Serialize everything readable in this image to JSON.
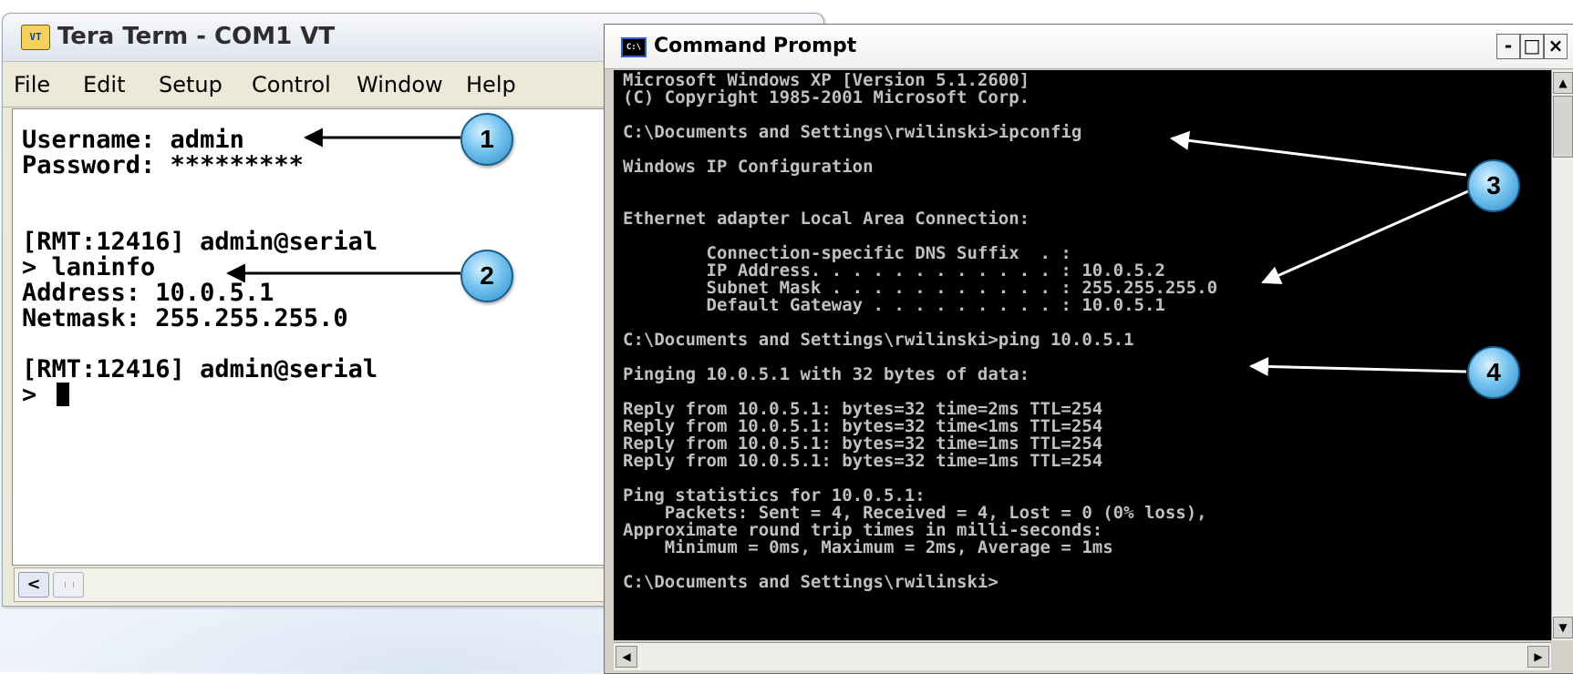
{
  "tera_term": {
    "title": "Tera Term - COM1 VT",
    "app_icon_text": "VT",
    "menu": [
      "File",
      "Edit",
      "Setup",
      "Control",
      "Window",
      "Help"
    ],
    "terminal_lines": [
      "Username: admin",
      "Password: *********",
      "",
      "",
      "[RMT:12416] admin@serial",
      "> laninfo",
      "Address: 10.0.5.1",
      "Netmask: 255.255.255.0",
      "",
      "[RMT:12416] admin@serial",
      "> "
    ]
  },
  "command_prompt": {
    "title": "Command Prompt",
    "icon_text": "C:\\",
    "buttons": {
      "minimize": "-",
      "maximize": "□",
      "close": "×"
    },
    "console_lines": [
      "Microsoft Windows XP [Version 5.1.2600]",
      "(C) Copyright 1985-2001 Microsoft Corp.",
      "",
      "C:\\Documents and Settings\\rwilinski>ipconfig",
      "",
      "Windows IP Configuration",
      "",
      "",
      "Ethernet adapter Local Area Connection:",
      "",
      "        Connection-specific DNS Suffix  . :",
      "        IP Address. . . . . . . . . . . . : 10.0.5.2",
      "        Subnet Mask . . . . . . . . . . . : 255.255.255.0",
      "        Default Gateway . . . . . . . . . : 10.0.5.1",
      "",
      "C:\\Documents and Settings\\rwilinski>ping 10.0.5.1",
      "",
      "Pinging 10.0.5.1 with 32 bytes of data:",
      "",
      "Reply from 10.0.5.1: bytes=32 time=2ms TTL=254",
      "Reply from 10.0.5.1: bytes=32 time<1ms TTL=254",
      "Reply from 10.0.5.1: bytes=32 time=1ms TTL=254",
      "Reply from 10.0.5.1: bytes=32 time=1ms TTL=254",
      "",
      "Ping statistics for 10.0.5.1:",
      "    Packets: Sent = 4, Received = 4, Lost = 0 (0% loss),",
      "Approximate round trip times in milli-seconds:",
      "    Minimum = 0ms, Maximum = 2ms, Average = 1ms",
      "",
      "C:\\Documents and Settings\\rwilinski>"
    ]
  },
  "callouts": [
    "1",
    "2",
    "3",
    "4"
  ],
  "colors": {
    "callout_fill": "#5cb6ea",
    "console_bg": "#000000",
    "console_text": "#c0c0c0",
    "terminal_bg": "#ffffff"
  }
}
